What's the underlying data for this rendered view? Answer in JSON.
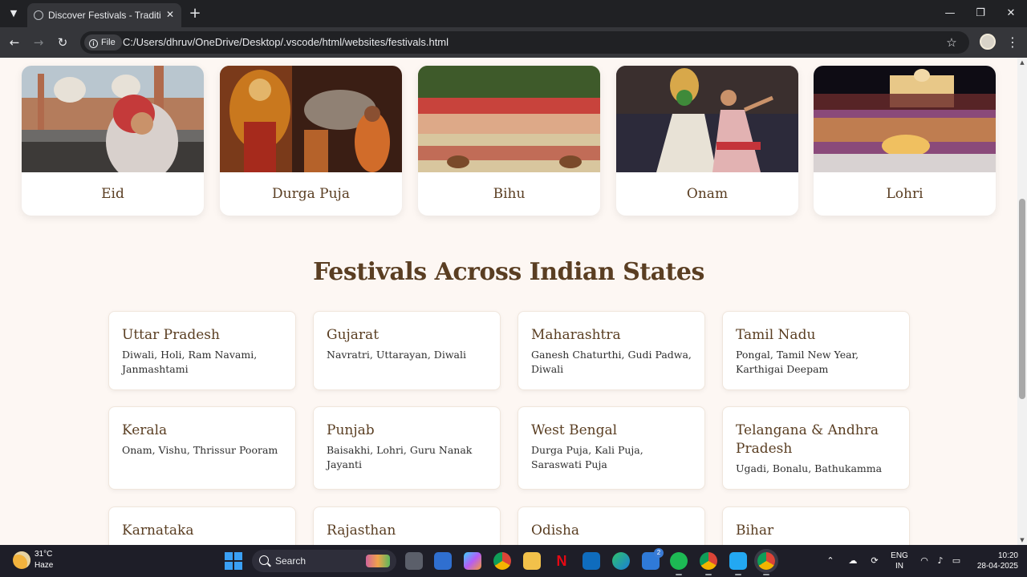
{
  "browser": {
    "tab_title": "Discover Festivals - Traditional I",
    "tab_menu_icon": "chevron-down-icon",
    "new_tab_symbol": "+",
    "close_symbol": "✕",
    "file_chip": "File",
    "url": "C:/Users/dhruv/OneDrive/Desktop/.vscode/html/websites/festivals.html"
  },
  "festivals": [
    {
      "name": "Eid"
    },
    {
      "name": "Durga Puja"
    },
    {
      "name": "Bihu"
    },
    {
      "name": "Onam"
    },
    {
      "name": "Lohri"
    }
  ],
  "states_section": {
    "title": "Festivals Across Indian States",
    "states": [
      {
        "name": "Uttar Pradesh",
        "festivals": "Diwali, Holi, Ram Navami, Janmashtami"
      },
      {
        "name": "Gujarat",
        "festivals": "Navratri, Uttarayan, Diwali"
      },
      {
        "name": "Maharashtra",
        "festivals": "Ganesh Chaturthi, Gudi Padwa, Diwali"
      },
      {
        "name": "Tamil Nadu",
        "festivals": "Pongal, Tamil New Year, Karthigai Deepam"
      },
      {
        "name": "Kerala",
        "festivals": "Onam, Vishu, Thrissur Pooram"
      },
      {
        "name": "Punjab",
        "festivals": "Baisakhi, Lohri, Guru Nanak Jayanti"
      },
      {
        "name": "West Bengal",
        "festivals": "Durga Puja, Kali Puja, Saraswati Puja"
      },
      {
        "name": "Telangana & Andhra Pradesh",
        "festivals": "Ugadi, Bonalu, Bathukamma"
      },
      {
        "name": "Karnataka",
        "festivals": ""
      },
      {
        "name": "Rajasthan",
        "festivals": ""
      },
      {
        "name": "Odisha",
        "festivals": ""
      },
      {
        "name": "Bihar",
        "festivals": ""
      }
    ]
  },
  "taskbar": {
    "weather_temp": "31°C",
    "weather_desc": "Haze",
    "search_label": "Search",
    "badge_count": "2",
    "lang_line1": "ENG",
    "lang_line2": "IN",
    "time": "10:20",
    "date": "28-04-2025"
  },
  "colors": {
    "page_bg": "#fdf7f3",
    "heading": "#5a3e22",
    "chrome_dark": "#202124",
    "chrome_mid": "#35363a",
    "taskbar": "#1e1e28"
  }
}
